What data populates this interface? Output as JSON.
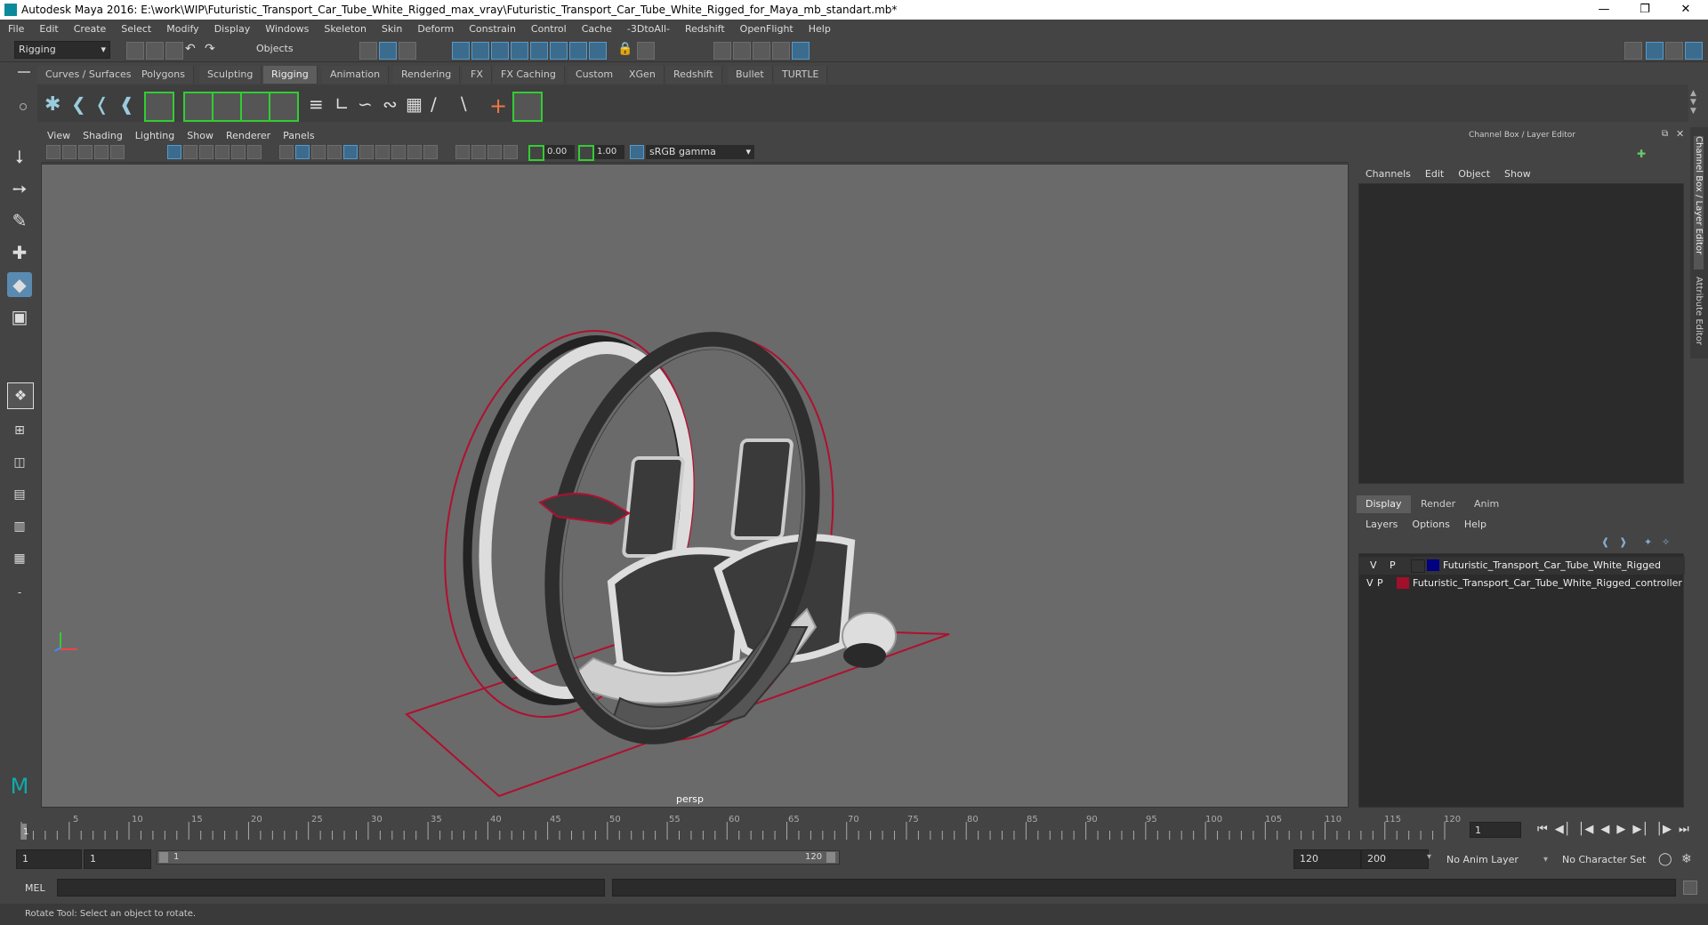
{
  "window": {
    "title": "Autodesk Maya 2016: E:\\work\\WIP\\Futuristic_Transport_Car_Tube_White_Rigged_max_vray\\Futuristic_Transport_Car_Tube_White_Rigged_for_Maya_mb_standart.mb*",
    "controls": [
      "minimize-icon",
      "restore-icon",
      "close-icon"
    ]
  },
  "menubar": [
    "File",
    "Edit",
    "Create",
    "Select",
    "Modify",
    "Display",
    "Windows",
    "Skeleton",
    "Skin",
    "Deform",
    "Constrain",
    "Control",
    "Cache",
    "-3DtoAll-",
    "Redshift",
    "OpenFlight",
    "Help"
  ],
  "statusline": {
    "menuset": "Rigging",
    "selection_mode": "Objects"
  },
  "shelf": {
    "tabs": [
      "Curves / Surfaces",
      "Polygons",
      "Sculpting",
      "Rigging",
      "Animation",
      "Rendering",
      "FX",
      "FX Caching",
      "Custom",
      "XGen",
      "Redshift",
      "Bullet",
      "TURTLE"
    ],
    "active_tab": "Rigging"
  },
  "viewport": {
    "menu": [
      "View",
      "Shading",
      "Lighting",
      "Show",
      "Renderer",
      "Panels"
    ],
    "exposure": "0.00",
    "gamma": "1.00",
    "colorspace": "sRGB gamma",
    "camera_label": "persp"
  },
  "right_panel": {
    "title": "Channel Box / Layer Editor",
    "channel_menu": [
      "Channels",
      "Edit",
      "Object",
      "Show"
    ],
    "layer_tabs": [
      "Display",
      "Render",
      "Anim"
    ],
    "active_layer_tab": "Display",
    "layer_menu": [
      "Layers",
      "Options",
      "Help"
    ],
    "layers": [
      {
        "v": "V",
        "p": "P",
        "name": "Futuristic_Transport_Car_Tube_White_Rigged",
        "color": "#000080"
      },
      {
        "v": "V",
        "p": "P",
        "name": "Futuristic_Transport_Car_Tube_White_Rigged_controller",
        "color": "#a0102a"
      }
    ],
    "side_tabs": [
      "Channel Box / Layer Editor",
      "Attribute Editor"
    ]
  },
  "timeline": {
    "ticks": [
      "1",
      "5",
      "10",
      "15",
      "20",
      "25",
      "30",
      "35",
      "40",
      "45",
      "50",
      "55",
      "60",
      "65",
      "70",
      "75",
      "80",
      "85",
      "90",
      "95",
      "100",
      "105",
      "110",
      "115",
      "120"
    ],
    "current_frame": "1"
  },
  "range": {
    "start": "1",
    "playback_start": "1",
    "slider_start": "1",
    "slider_end": "120",
    "playback_end": "120",
    "end": "200",
    "anim_layer": "No Anim Layer",
    "character_set": "No Character Set"
  },
  "command": {
    "lang": "MEL"
  },
  "help_line": "Rotate Tool: Select an object to rotate."
}
